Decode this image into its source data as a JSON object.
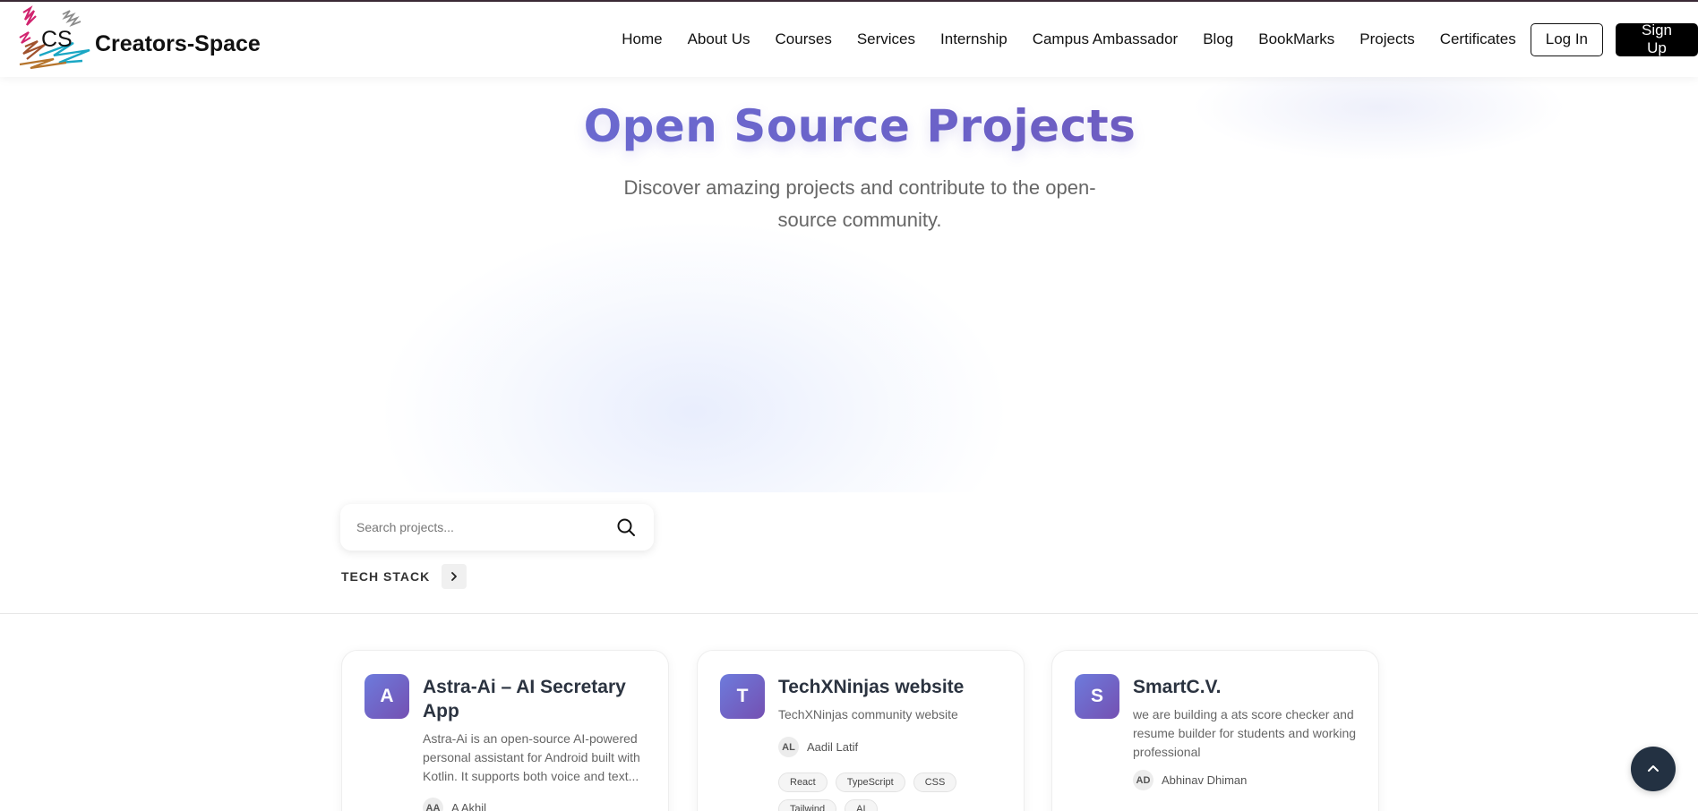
{
  "brand": {
    "logo_text": "CS",
    "name": "Creators-Space"
  },
  "nav": {
    "links": [
      "Home",
      "About Us",
      "Courses",
      "Services",
      "Internship",
      "Campus Ambassador",
      "Blog",
      "BookMarks",
      "Projects",
      "Certificates"
    ],
    "login_label": "Log In",
    "signup_label": "Sign Up"
  },
  "hero": {
    "title": "Open Source Projects",
    "subtitle": "Discover amazing projects and contribute to the open-source community."
  },
  "search": {
    "placeholder": "Search projects...",
    "value": ""
  },
  "filters": {
    "tech_stack_label": "TECH STACK"
  },
  "projects": [
    {
      "initial": "A",
      "title": "Astra-Ai – AI Secretary App",
      "description": "Astra-Ai is an open-source AI-powered personal assistant for Android built with Kotlin. It supports both voice and text...",
      "author_initials": "AA",
      "author": "A Akhil",
      "tags": []
    },
    {
      "initial": "T",
      "title": "TechXNinjas website",
      "description": "TechXNinjas community website",
      "author_initials": "AL",
      "author": "Aadil Latif",
      "tags": [
        "React",
        "TypeScript",
        "CSS",
        "Tailwind",
        "AI"
      ]
    },
    {
      "initial": "S",
      "title": "SmartC.V.",
      "description": "we are building a ats score checker and resume builder for students and working professional",
      "author_initials": "AD",
      "author": "Abhinav Dhiman",
      "tags": []
    }
  ],
  "colors": {
    "accent_start": "#6a76dd",
    "accent_end": "#7648a8",
    "primary_button": "#000000",
    "back_to_top": "#233142"
  },
  "icons": {
    "search": "search-icon",
    "tech_stack_toggle": "chevron-right-icon",
    "back_to_top": "chevron-up-icon"
  }
}
